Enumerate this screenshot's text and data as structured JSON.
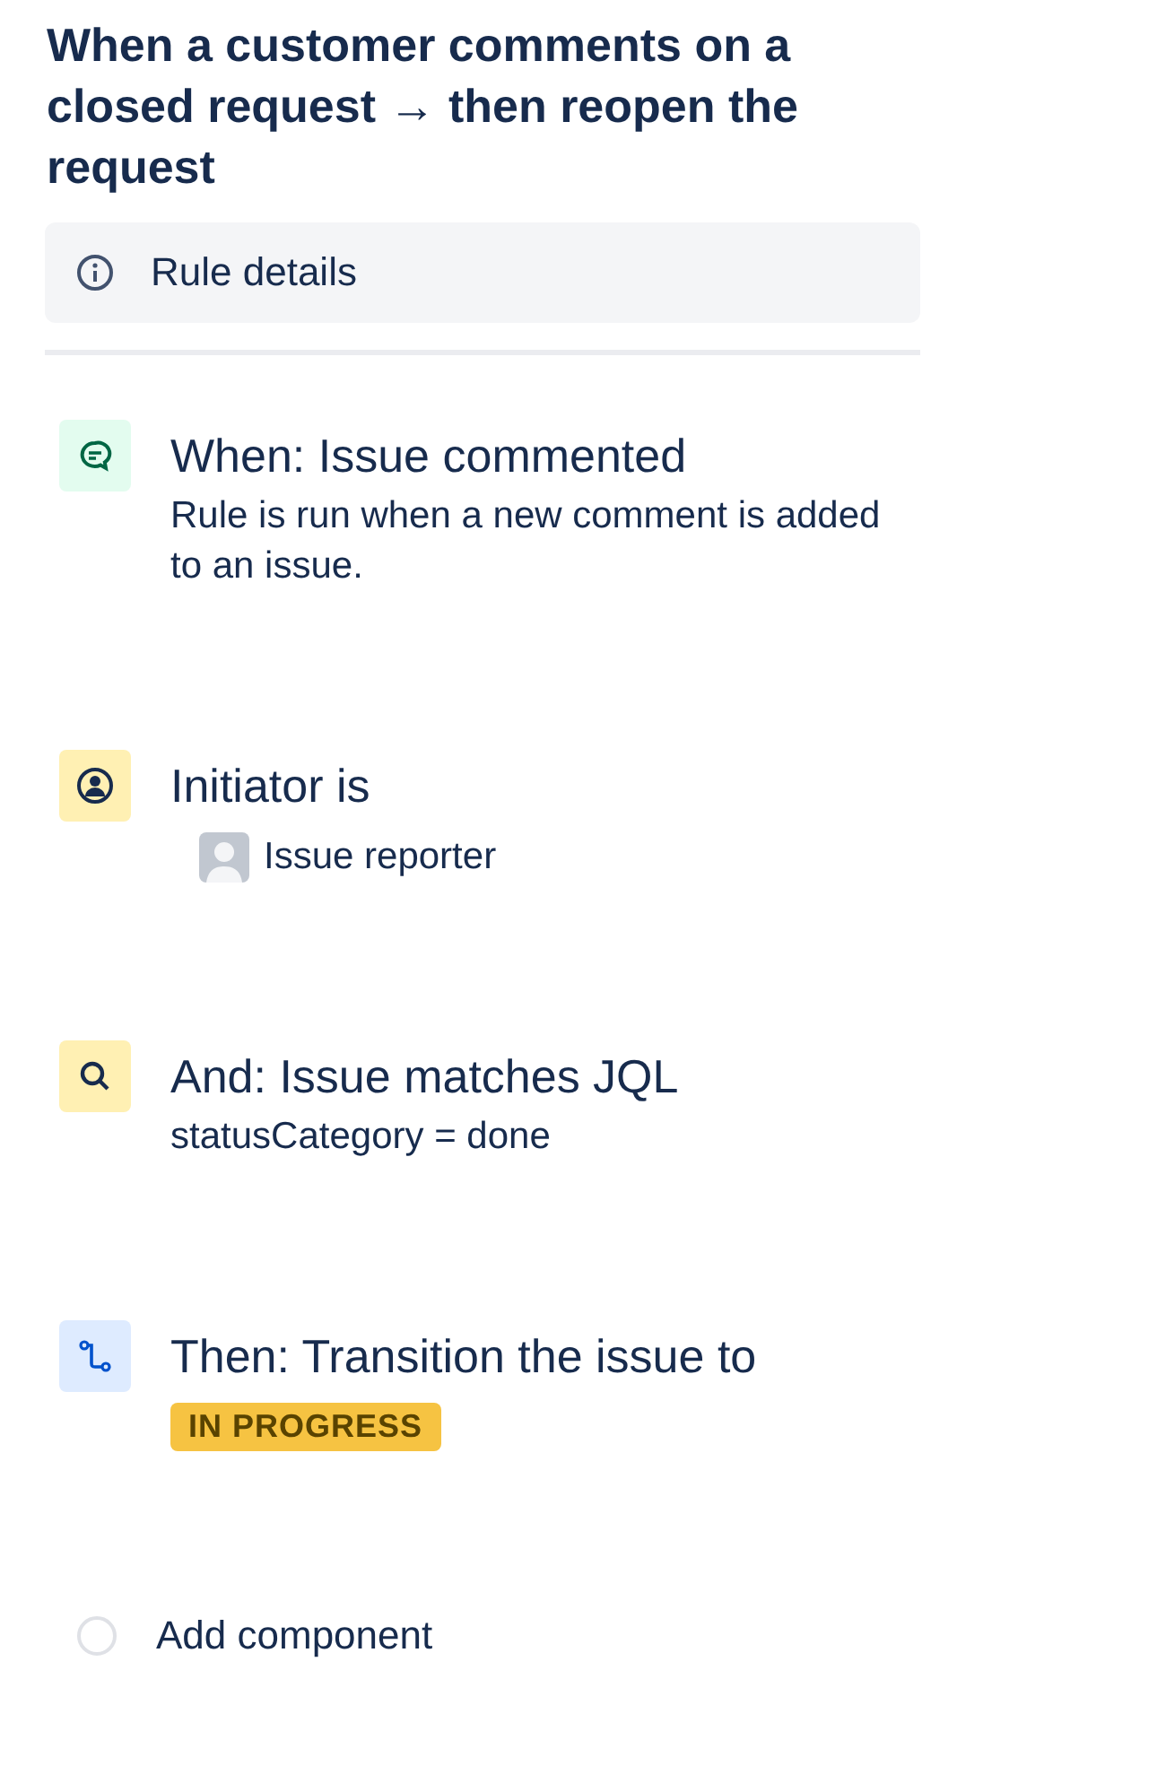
{
  "title": "When a customer comments on a closed request → then reopen the request",
  "rule_details": {
    "label": "Rule details"
  },
  "steps": [
    {
      "kind": "trigger",
      "title": "When: Issue commented",
      "detail": {
        "kind": "text",
        "text": "Rule is run when a new comment is added to an issue."
      }
    },
    {
      "kind": "user-condition",
      "title": "Initiator is",
      "detail": {
        "kind": "user",
        "text": "Issue reporter"
      }
    },
    {
      "kind": "search-condition",
      "title": "And: Issue matches JQL",
      "detail": {
        "kind": "text",
        "text": "statusCategory = done"
      }
    },
    {
      "kind": "action",
      "title": "Then: Transition the issue to",
      "detail": {
        "kind": "lozenge",
        "text": "IN PROGRESS"
      }
    }
  ],
  "add_component": {
    "label": "Add component"
  }
}
